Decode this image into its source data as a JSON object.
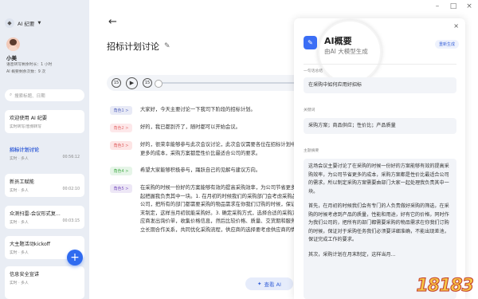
{
  "app": {
    "name": "AI 纪要"
  },
  "window": {
    "controls": [
      "–",
      "□",
      "×"
    ]
  },
  "user": {
    "name": "小美",
    "quota_line1": "语音转写剩余时长：1 小时",
    "quota_line2": "AI 概要剩余次数：9 次"
  },
  "search": {
    "placeholder": "搜索标题、日期"
  },
  "cards": [
    {
      "title": "欢迎使用 AI 纪要",
      "subtitle": "实时转写/音频转写",
      "time": ""
    },
    {
      "title": "招标计划讨论",
      "subtitle": "实时 · 多人",
      "time": "00:56:12"
    },
    {
      "title": "新员工赋能",
      "subtitle": "实时 · 多人",
      "time": "00:02:10"
    },
    {
      "title": "众测扫雷-会议形式复...",
      "subtitle": "实时 · 多人",
      "time": "00:03:15"
    },
    {
      "title": "大主题活动kickoff",
      "subtitle": "实时 · 多人",
      "time": ""
    },
    {
      "title": "信息安全宣讲",
      "subtitle": "实时 · 多人",
      "time": ""
    }
  ],
  "fab": {
    "label": "+"
  },
  "main": {
    "back": "←",
    "title": "招标计划讨论",
    "edit_icon": "✎",
    "rewind": "15",
    "forward": "15",
    "view_more": "查看 AI"
  },
  "transcript": [
    {
      "speaker": "角色1 >",
      "color": "c1",
      "text": "大家好，今天主要讨论一下我司下阶段的招标计划。"
    },
    {
      "speaker": "角色2 >",
      "color": "c2",
      "text": "好的，我已都到齐了，随时都可以开始会议。"
    },
    {
      "speaker": "角色3 >",
      "color": "c3",
      "text": "好的，很荣幸能够参与此次会议讨论，此次会议需要各位在招标计划中务必须提高采购效率，为公司节省更多的成本，采购方案都是性价比最适合公司的要求。"
    },
    {
      "speaker": "角色4 >",
      "color": "c4",
      "text": "希望大家能够积极参与，踊跃自己的见解与建议方向。"
    },
    {
      "speaker": "角色5 >",
      "color": "c5",
      "text": "在采购的时候一份好的方案能够有效的提高采购效率，为公司节省更多成本，采购方案需要各部门大家一起把握我负责其中一块。1. 在月初的时候我们的采购部门会考虑采购品的质量、性能和用途，对于我们的公司，把所有的部门都需要采购的物品需求在你我们订购的时候，保证完成工作的要求。2. 供应计划在月末制定，这样当月初就能采购好。3. 确定采购方式，选择合适的采购方法。3. 询价采购：企业向多家供应商发出询价单，收集价格信息，然后比较价格、质量、交货期和服务，4. 供应商筛选：企业与供应商建立长期合作关系，共同优化采购流程，供应商的选择要考虑供应商的情况。"
    }
  ],
  "ai_panel": {
    "title": "AI概要",
    "subtitle": "由AI 大模型生成",
    "regen": "重新生成",
    "close": "×",
    "label_summary_line": "一句话总结",
    "summary_line": "在采购中如何应用好招标",
    "label_keywords": "关键词",
    "keywords": "采购方案；商品供应；性价比；产品质量",
    "label_topic": "主题摘要",
    "topic_p1": "这场会议主要讨论了在采购的时候一份好的方案能够有效的提高采购效率，为公司节省更多的成本，采购方案都是性价比最适合公司的需求，所以制定采购方案需要由部门大家一起处理我负责其中一块。",
    "topic_p2": "首先，在月初的时候我们会有专门的人负责做好采购的筛选，在采购的时候考虑到产品的质量，性能和用途，好有它的价格，同时作为我们公司的，把所有的部门都需要采购的物品需求在你我们订购的时候，保证对于采购任务我们必须要详细准确，不能出现差池，保证完成工作的要求。",
    "topic_p3": "其次，采购计划在月末制定，这样当月..."
  },
  "watermark": "18183"
}
